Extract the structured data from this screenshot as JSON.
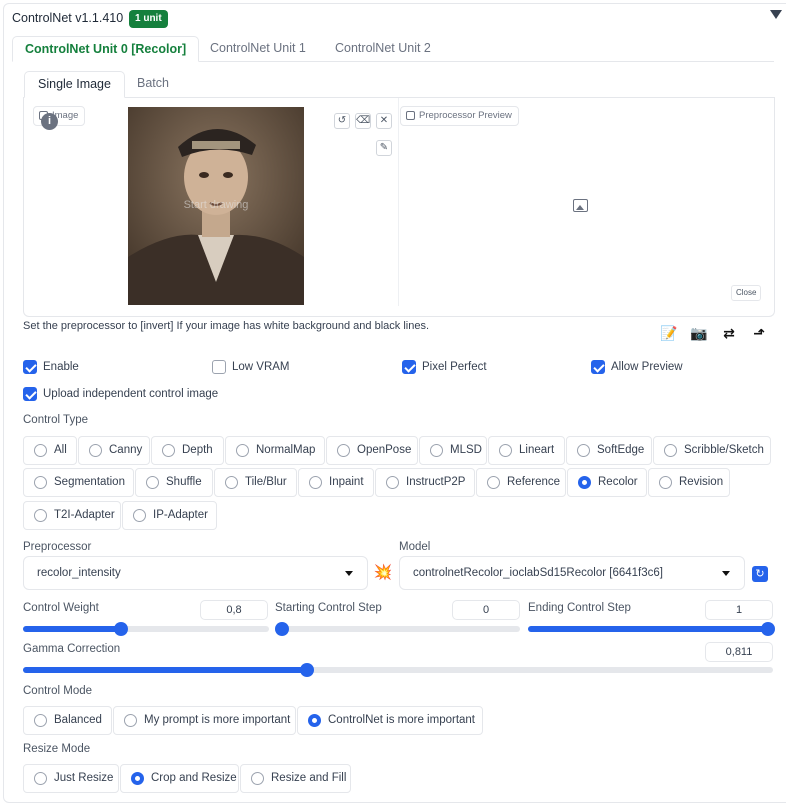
{
  "header": {
    "title": "ControlNet v1.1.410",
    "badge": "1 unit"
  },
  "unit_tabs": [
    {
      "label": "ControlNet Unit 0 [Recolor]",
      "active": true
    },
    {
      "label": "ControlNet Unit 1",
      "active": false
    },
    {
      "label": "ControlNet Unit 2",
      "active": false
    }
  ],
  "image_tabs": [
    {
      "label": "Single Image",
      "active": true
    },
    {
      "label": "Batch",
      "active": false
    }
  ],
  "image_panel": {
    "image_label": "Image",
    "overlay_text": "Start drawing",
    "preview_label": "Preprocessor Preview",
    "close_label": "Close",
    "info_glyph": "i"
  },
  "hint": "Set the preprocessor to [invert] If your image has white background and black lines.",
  "checkboxes": [
    {
      "label": "Enable",
      "checked": true
    },
    {
      "label": "Low VRAM",
      "checked": false
    },
    {
      "label": "Pixel Perfect",
      "checked": true
    },
    {
      "label": "Allow Preview",
      "checked": true
    },
    {
      "label": "Upload independent control image",
      "checked": true
    }
  ],
  "control_type": {
    "label": "Control Type",
    "options": [
      "All",
      "Canny",
      "Depth",
      "NormalMap",
      "OpenPose",
      "MLSD",
      "Lineart",
      "SoftEdge",
      "Scribble/Sketch",
      "Segmentation",
      "Shuffle",
      "Tile/Blur",
      "Inpaint",
      "InstructP2P",
      "Reference",
      "Recolor",
      "Revision",
      "T2I-Adapter",
      "IP-Adapter"
    ],
    "selected": "Recolor"
  },
  "preprocessor": {
    "label": "Preprocessor",
    "value": "recolor_intensity"
  },
  "model": {
    "label": "Model",
    "value": "controlnetRecolor_ioclabSd15Recolor [6641f3c6]"
  },
  "sliders": {
    "control_weight": {
      "label": "Control Weight",
      "value": "0,8",
      "fraction": 0.4
    },
    "starting_step": {
      "label": "Starting Control Step",
      "value": "0",
      "fraction": 0.0
    },
    "ending_step": {
      "label": "Ending Control Step",
      "value": "1",
      "fraction": 1.0
    },
    "gamma": {
      "label": "Gamma Correction",
      "value": "0,811",
      "fraction": 0.378
    }
  },
  "control_mode": {
    "label": "Control Mode",
    "options": [
      "Balanced",
      "My prompt is more important",
      "ControlNet is more important"
    ],
    "selected": "ControlNet is more important"
  },
  "resize_mode": {
    "label": "Resize Mode",
    "options": [
      "Just Resize",
      "Crop and Resize",
      "Resize and Fill"
    ],
    "selected": "Crop and Resize"
  },
  "icons": [
    "collapse-icon",
    "image-icon",
    "undo-icon",
    "eraser-icon",
    "close-icon",
    "brush-icon",
    "placeholder-image-icon",
    "notepad-icon",
    "camera-icon",
    "swap-icon",
    "send-icon",
    "explosion-icon",
    "refresh-icon"
  ],
  "colors": {
    "accent": "#2563eb",
    "badge": "#15803d",
    "active_tab_text": "#15803d"
  }
}
